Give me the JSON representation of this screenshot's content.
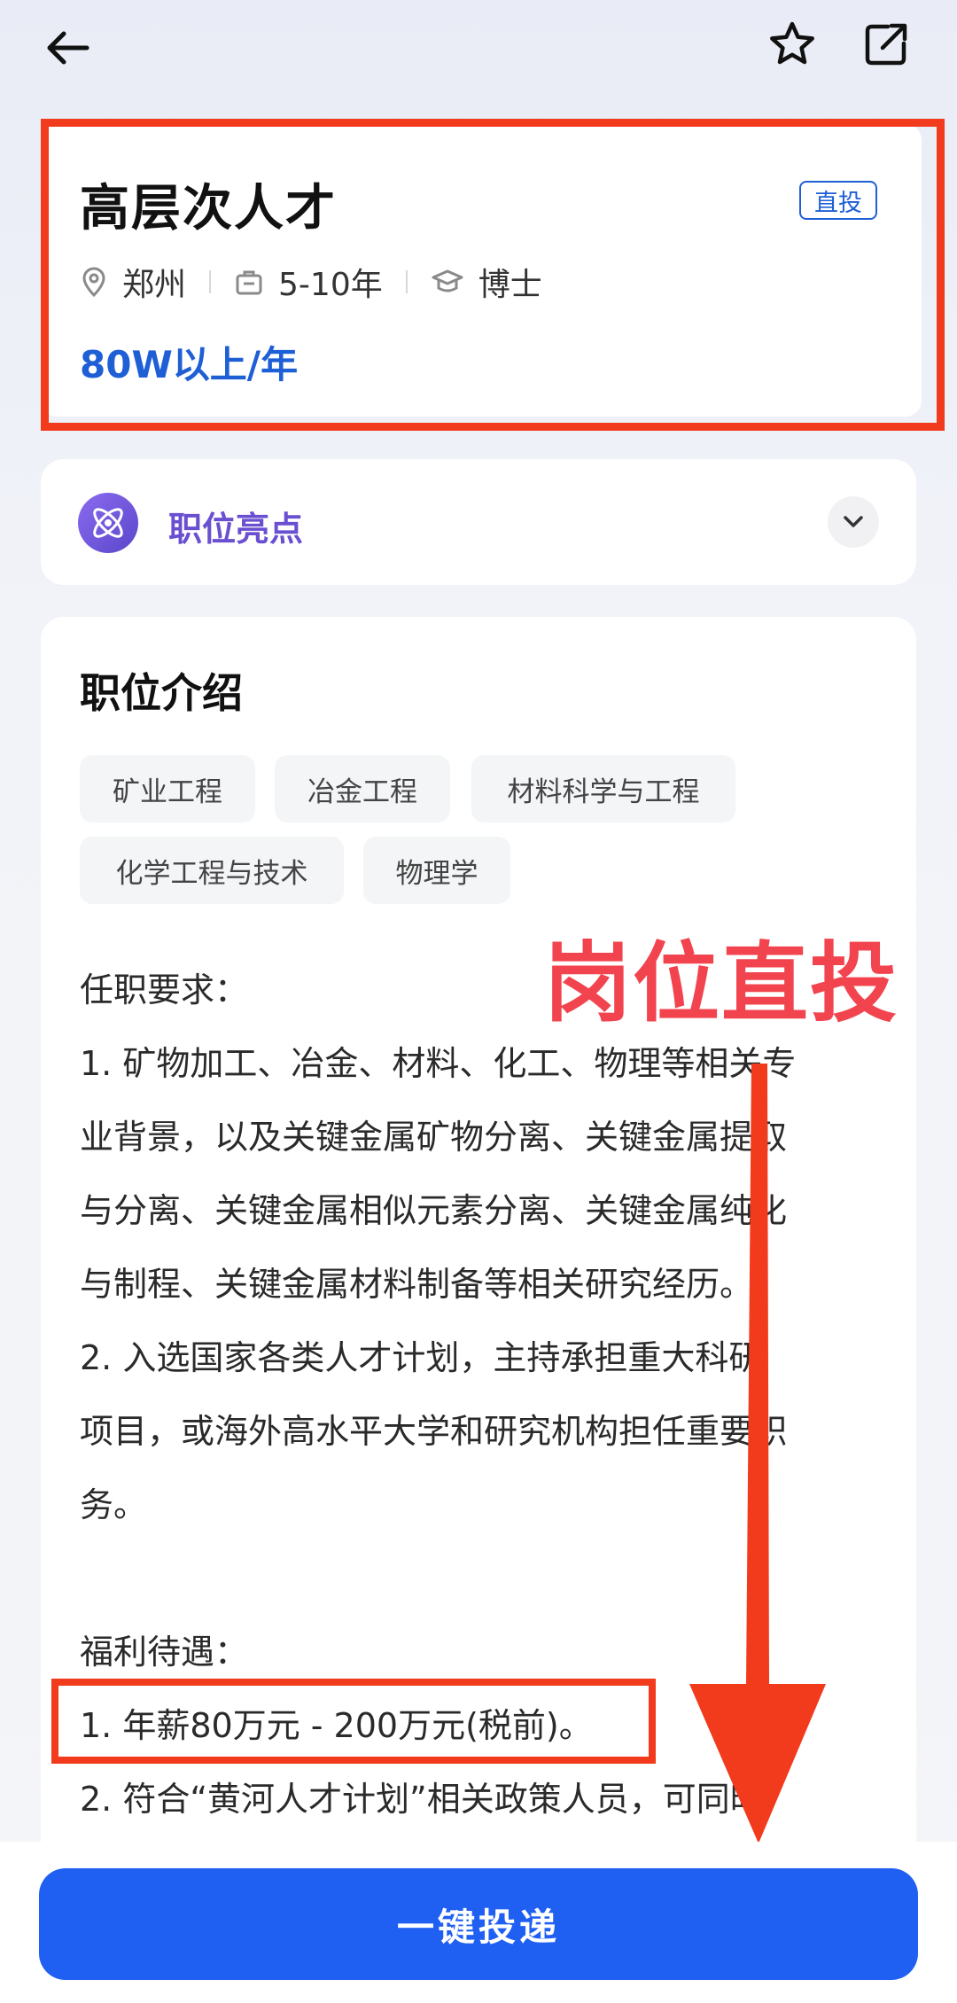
{
  "job": {
    "title": "高层次人才",
    "badge": "直投",
    "location": "郑州",
    "experience": "5-10年",
    "education": "博士",
    "salary": "80W以上/年"
  },
  "highlight": {
    "label": "职位亮点",
    "icon": "atom-icon"
  },
  "intro": {
    "title": "职位介绍",
    "tags": [
      "矿业工程",
      "冶金工程",
      "材料科学与工程",
      "化学工程与技术",
      "物理学"
    ],
    "lines": [
      "任职要求：",
      "1. 矿物加工、冶金、材料、化工、物理等相关专",
      "业背景，以及关键金属矿物分离、关键金属提取",
      "与分离、关键金属相似元素分离、关键金属纯化",
      "与制程、关键金属材料制备等相关研究经历。",
      "2. 入选国家各类人才计划，主持承担重大科研",
      "项目，或海外高水平大学和研究机构担任重要职",
      "务。",
      "",
      "福利待遇：",
      "1. 年薪80万元 - 200万元(税前)。",
      "2. 符合“黄河人才计划”相关政策人员，可同时"
    ]
  },
  "annotation": {
    "text": "岗位直投"
  },
  "actions": {
    "submit": "一键投递"
  },
  "colors": {
    "accent": "#1f5ff2",
    "salary": "#1e5fd6",
    "highlight": "#6a4fd1",
    "annotation": "#f23a1c"
  }
}
